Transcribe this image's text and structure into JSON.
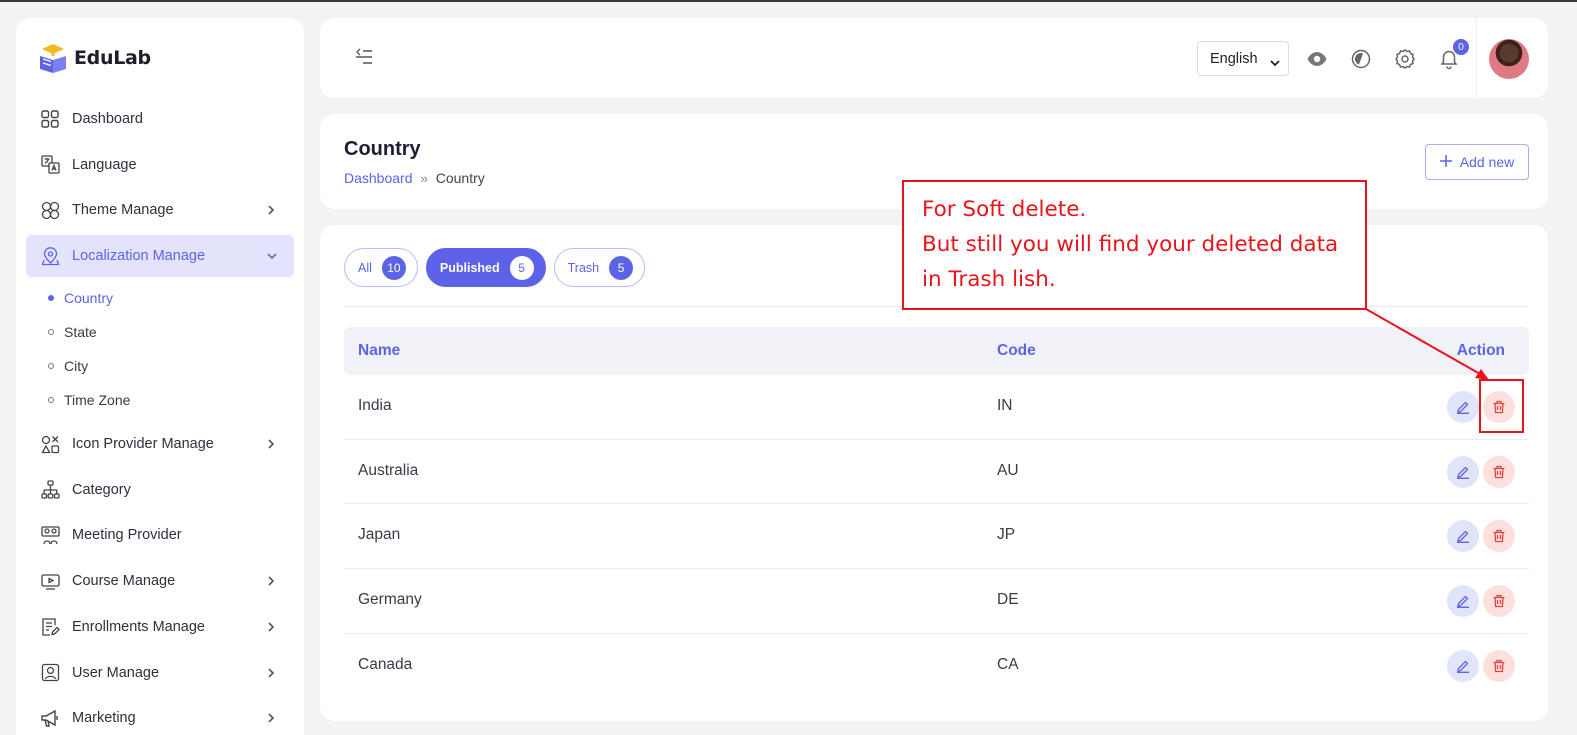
{
  "brand": {
    "name": "EduLab"
  },
  "sidebar": {
    "items": [
      {
        "label": "Dashboard",
        "icon": "grid-icon",
        "chevron": false
      },
      {
        "label": "Language",
        "icon": "translate-icon",
        "chevron": false
      },
      {
        "label": "Theme Manage",
        "icon": "flower-icon",
        "chevron": true
      },
      {
        "label": "Localization Manage",
        "icon": "map-pin-icon",
        "chevron": true,
        "active": true,
        "children": [
          {
            "label": "Country",
            "active": true
          },
          {
            "label": "State"
          },
          {
            "label": "City"
          },
          {
            "label": "Time Zone"
          }
        ]
      },
      {
        "label": "Icon Provider Manage",
        "icon": "shapes-icon",
        "chevron": true
      },
      {
        "label": "Category",
        "icon": "hierarchy-icon",
        "chevron": false
      },
      {
        "label": "Meeting Provider",
        "icon": "people-icon",
        "chevron": false
      },
      {
        "label": "Course Manage",
        "icon": "video-icon",
        "chevron": true
      },
      {
        "label": "Enrollments Manage",
        "icon": "document-edit-icon",
        "chevron": true
      },
      {
        "label": "User Manage",
        "icon": "user-square-icon",
        "chevron": true
      },
      {
        "label": "Marketing",
        "icon": "megaphone-icon",
        "chevron": true
      }
    ]
  },
  "topbar": {
    "language": "English",
    "notification_count": "0",
    "icons": [
      "eye-icon",
      "theme-toggle-icon",
      "gear-icon",
      "bell-icon"
    ]
  },
  "page": {
    "title": "Country",
    "breadcrumb": {
      "home": "Dashboard",
      "separator": "»",
      "current": "Country"
    },
    "add_button": "Add new"
  },
  "tabs": [
    {
      "label": "All",
      "count": "10",
      "active": false
    },
    {
      "label": "Published",
      "count": "5",
      "active": true
    },
    {
      "label": "Trash",
      "count": "5",
      "active": false
    }
  ],
  "table": {
    "headers": {
      "name": "Name",
      "code": "Code",
      "action": "Action"
    },
    "rows": [
      {
        "name": "India",
        "code": "IN"
      },
      {
        "name": "Australia",
        "code": "AU"
      },
      {
        "name": "Japan",
        "code": "JP"
      },
      {
        "name": "Germany",
        "code": "DE"
      },
      {
        "name": "Canada",
        "code": "CA"
      }
    ]
  },
  "annotation": {
    "lines": [
      "For Soft delete.",
      "But still you will find your deleted data",
      "in Trash lish."
    ],
    "color": "#e8141c"
  },
  "colors": {
    "accent": "#5c63e7",
    "danger": "#e8141c",
    "background": "#f3f3f5"
  }
}
